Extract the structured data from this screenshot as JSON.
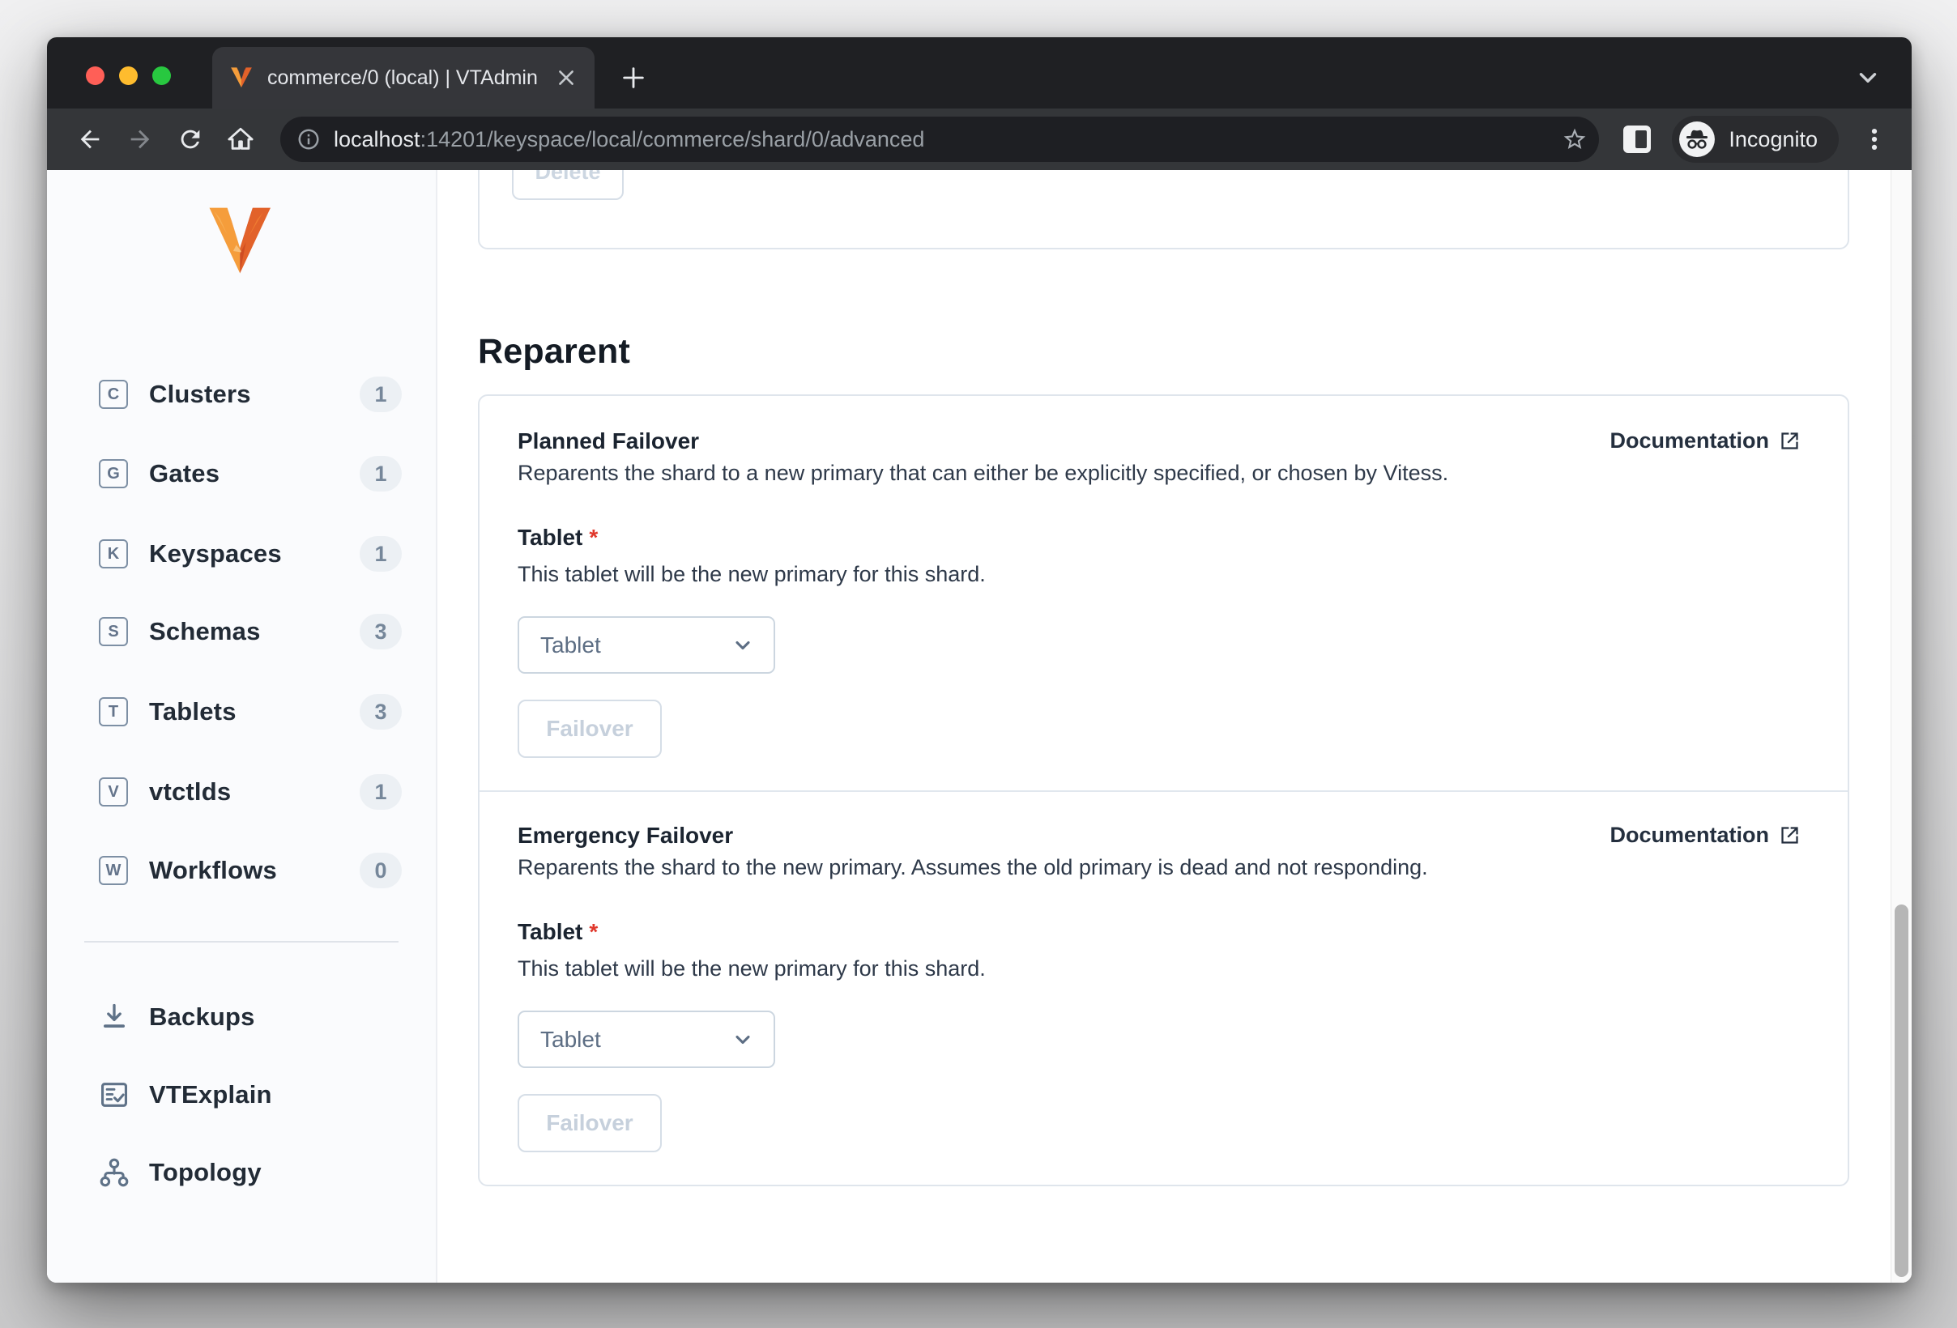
{
  "browser": {
    "tab_title": "commerce/0 (local) | VTAdmin",
    "url_host": "localhost",
    "url_rest": ":14201/keyspace/local/commerce/shard/0/advanced",
    "incognito_label": "Incognito"
  },
  "sidebar": {
    "items": [
      {
        "letter": "C",
        "label": "Clusters",
        "count": "1"
      },
      {
        "letter": "G",
        "label": "Gates",
        "count": "1"
      },
      {
        "letter": "K",
        "label": "Keyspaces",
        "count": "1"
      },
      {
        "letter": "S",
        "label": "Schemas",
        "count": "3"
      },
      {
        "letter": "T",
        "label": "Tablets",
        "count": "3"
      },
      {
        "letter": "V",
        "label": "vtctlds",
        "count": "1"
      },
      {
        "letter": "W",
        "label": "Workflows",
        "count": "0"
      }
    ],
    "tools": [
      {
        "icon": "download-icon",
        "label": "Backups"
      },
      {
        "icon": "checklist-icon",
        "label": "VTExplain"
      },
      {
        "icon": "topology-icon",
        "label": "Topology"
      }
    ]
  },
  "main": {
    "delete_button_label": "Delete",
    "section_title": "Reparent",
    "cards": [
      {
        "title": "Planned Failover",
        "doc_label": "Documentation",
        "description": "Reparents the shard to a new primary that can either be explicitly specified, or chosen by Vitess.",
        "field_label": "Tablet",
        "required_mark": "*",
        "field_description": "This tablet will be the new primary for this shard.",
        "select_value": "Tablet",
        "button_label": "Failover"
      },
      {
        "title": "Emergency Failover",
        "doc_label": "Documentation",
        "description": "Reparents the shard to the new primary. Assumes the old primary is dead and not responding.",
        "field_label": "Tablet",
        "required_mark": "*",
        "field_description": "This tablet will be the new primary for this shard.",
        "select_value": "Tablet",
        "button_label": "Failover"
      }
    ]
  },
  "colors": {
    "brand_orange": "#f08a2e",
    "required_red": "#e0382c",
    "chrome_frame": "#1f2023",
    "chrome_toolbar": "#343639"
  }
}
